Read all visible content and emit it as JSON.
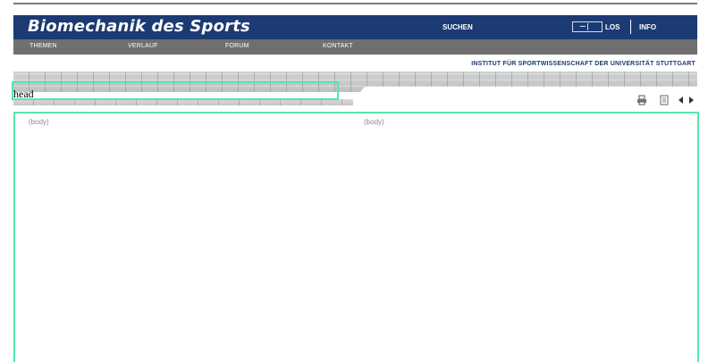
{
  "header": {
    "title": "Biomechanik des Sports",
    "search_label": "SUCHEN",
    "go_label": "LOS",
    "info_label": "INFO",
    "brand_color": "#1c3a73"
  },
  "nav": {
    "items": [
      {
        "label": "THEMEN"
      },
      {
        "label": "VERLAUF"
      },
      {
        "label": "FORUM"
      },
      {
        "label": "KONTAKT"
      }
    ],
    "color": "#6f6f70"
  },
  "institute": "INSTITUT FÜR SPORTWISSENSCHAFT DER UNIVERSITÄT STUTTGART",
  "banner": {
    "region_label": "head",
    "highlight_color": "#55e7a8"
  },
  "tools": [
    {
      "icon": "print-icon"
    },
    {
      "icon": "document-icon"
    },
    {
      "icon": "arrow-left-icon"
    },
    {
      "icon": "arrow-right-icon"
    }
  ],
  "body": {
    "left_label": "(body)",
    "right_label": "(body)"
  }
}
